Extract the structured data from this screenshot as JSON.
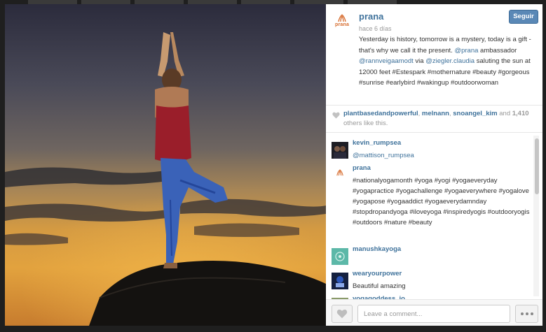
{
  "post": {
    "username": "prana",
    "brand_word": "prana",
    "time_ago": "hace 6 días",
    "follow_label": "Seguir",
    "caption_parts": {
      "p1": "Yesterday is history, tomorrow is a mystery, today is a gift - that's why we call it the present. ",
      "mention1": "@prana",
      "p2": " ambassador ",
      "mention2": "@rannveigaamodt",
      "p3": " via ",
      "mention3": "@ziegler.claudia",
      "p4": " saluting the sun at 12000 feet #Estespark #mothernature #beauty #gorgeous #sunrise #earlybird #wakingup #outdoorwoman"
    }
  },
  "likes": {
    "user1": "plantbasedandpowerful",
    "sep1": ", ",
    "user2": "melnann",
    "sep2": ", ",
    "user3": "snoangel_kim",
    "and_label": " and ",
    "count": "1,410",
    "others_label": " others like this."
  },
  "comments": [
    {
      "user": "kevin_rumpsea",
      "text": "@mattison_rumpsea"
    },
    {
      "user": "prana",
      "text": "#nationalyogamonth #yoga #yogi #yogaeveryday #yogapractice #yogachallenge #yogaeverywhere #yogalove #yogapose #yogaaddict #yogaeverydamnday #stopdropandyoga #iloveyoga #inspiredyogis #outdooryogis #outdoors #nature #beauty"
    },
    {
      "user": "manushkayoga",
      "text": ""
    },
    {
      "user": "wearyourpower",
      "text": "Beautiful amazing"
    },
    {
      "user": "yogagoddess_jo",
      "text": ""
    }
  ],
  "comment_box": {
    "placeholder": "Leave a comment..."
  },
  "colors": {
    "link": "#3f729b",
    "follow": "#5a88b6",
    "brand": "#d66a2b"
  },
  "icons": {
    "like": "heart-icon",
    "more": "ellipsis-icon"
  }
}
